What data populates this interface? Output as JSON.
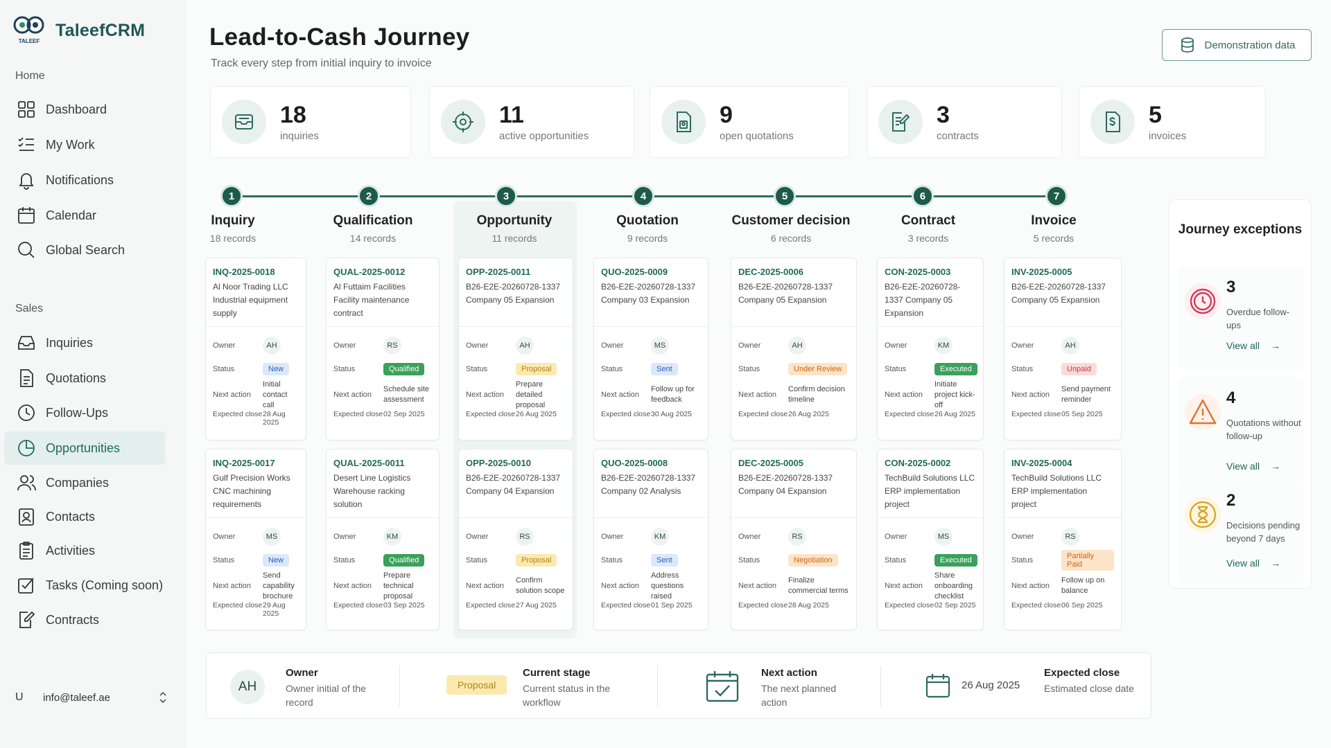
{
  "brand": {
    "name": "TaleefCRM",
    "logo_text": "TALEEF"
  },
  "sidebar": {
    "sections": {
      "home": "Home",
      "sales": "Sales"
    },
    "home_items": [
      {
        "label": "Dashboard",
        "icon": "dashboard-icon"
      },
      {
        "label": "My Work",
        "icon": "checklist-icon"
      },
      {
        "label": "Notifications",
        "icon": "bell-icon"
      },
      {
        "label": "Calendar",
        "icon": "calendar-icon"
      },
      {
        "label": "Global Search",
        "icon": "search-icon"
      }
    ],
    "sales_items": [
      {
        "label": "Inquiries",
        "icon": "inbox-icon"
      },
      {
        "label": "Quotations",
        "icon": "document-icon"
      },
      {
        "label": "Follow-Ups",
        "icon": "clock-icon"
      },
      {
        "label": "Opportunities",
        "icon": "pie-chart-icon",
        "active": true
      },
      {
        "label": "Companies",
        "icon": "users-icon"
      },
      {
        "label": "Contacts",
        "icon": "contact-card-icon"
      },
      {
        "label": "Activities",
        "icon": "clipboard-icon"
      },
      {
        "label": "Tasks (Coming soon)",
        "icon": "checkbox-icon"
      },
      {
        "label": "Contracts",
        "icon": "edit-document-icon"
      }
    ],
    "user": {
      "initial": "U",
      "email": "info@taleef.ae"
    }
  },
  "header": {
    "title": "Lead-to-Cash Journey",
    "subtitle": "Track every step from initial inquiry to invoice",
    "demo_button": "Demonstration data"
  },
  "kpis": [
    {
      "value": "18",
      "label": "inquiries"
    },
    {
      "value": "11",
      "label": "active opportunities"
    },
    {
      "value": "9",
      "label": "open quotations"
    },
    {
      "value": "3",
      "label": "contracts"
    },
    {
      "value": "5",
      "label": "invoices"
    }
  ],
  "labels": {
    "owner": "Owner",
    "status": "Status",
    "next_action": "Next action",
    "expected_close": "Expected close"
  },
  "stages": [
    {
      "num": "1",
      "name": "Inquiry",
      "count": "18 records",
      "cards": [
        {
          "code": "INQ-2025-0018",
          "desc": "Al Noor Trading LLC Industrial equipment supply",
          "owner": "AH",
          "status": "New",
          "next": "Initial contact call",
          "close": "28 Aug 2025"
        },
        {
          "code": "INQ-2025-0017",
          "desc": "Gulf Precision Works CNC machining requirements",
          "owner": "MS",
          "status": "New",
          "next": "Send capability brochure",
          "close": "29 Aug 2025"
        }
      ]
    },
    {
      "num": "2",
      "name": "Qualification",
      "count": "14 records",
      "cards": [
        {
          "code": "QUAL-2025-0012",
          "desc": "Al Futtaim Facilities Facility maintenance contract",
          "owner": "RS",
          "status": "Qualified",
          "next": "Schedule site assessment",
          "close": "02 Sep 2025"
        },
        {
          "code": "QUAL-2025-0011",
          "desc": "Desert Line Logistics Warehouse racking solution",
          "owner": "KM",
          "status": "Qualified",
          "next": "Prepare technical proposal",
          "close": "03 Sep 2025"
        }
      ]
    },
    {
      "num": "3",
      "name": "Opportunity",
      "count": "11 records",
      "cards": [
        {
          "code": "OPP-2025-0011",
          "desc": "B26-E2E-20260728-1337 Company 05 Expansion",
          "owner": "AH",
          "status": "Proposal",
          "next": "Prepare detailed proposal",
          "close": "26 Aug 2025"
        },
        {
          "code": "OPP-2025-0010",
          "desc": "B26-E2E-20260728-1337 Company 04 Expansion",
          "owner": "RS",
          "status": "Proposal",
          "next": "Confirm solution scope",
          "close": "27 Aug 2025"
        }
      ]
    },
    {
      "num": "4",
      "name": "Quotation",
      "count": "9 records",
      "cards": [
        {
          "code": "QUO-2025-0009",
          "desc": "B26-E2E-20260728-1337 Company 03 Expansion",
          "owner": "MS",
          "status": "Sent",
          "next": "Follow up for feedback",
          "close": "30 Aug 2025"
        },
        {
          "code": "QUO-2025-0008",
          "desc": "B26-E2E-20260728-1337 Company 02 Analysis",
          "owner": "KM",
          "status": "Sent",
          "next": "Address questions raised",
          "close": "01 Sep 2025"
        }
      ]
    },
    {
      "num": "5",
      "name": "Customer decision",
      "count": "6 records",
      "cards": [
        {
          "code": "DEC-2025-0006",
          "desc": "B26-E2E-20260728-1337 Company 05 Expansion",
          "owner": "AH",
          "status": "Under Review",
          "next": "Confirm decision timeline",
          "close": "26 Aug 2025"
        },
        {
          "code": "DEC-2025-0005",
          "desc": "B26-E2E-20260728-1337 Company 04 Expansion",
          "owner": "RS",
          "status": "Negotiation",
          "next": "Finalize commercial terms",
          "close": "28 Aug 2025"
        }
      ]
    },
    {
      "num": "6",
      "name": "Contract",
      "count": "3 records",
      "cards": [
        {
          "code": "CON-2025-0003",
          "desc": "B26-E2E-20260728-1337 Company 05 Expansion",
          "owner": "KM",
          "status": "Executed",
          "next": "Initiate project kick-off",
          "close": "26 Aug 2025"
        },
        {
          "code": "CON-2025-0002",
          "desc": "TechBuild Solutions LLC ERP implementation project",
          "owner": "MS",
          "status": "Executed",
          "next": "Share onboarding checklist",
          "close": "02 Sep 2025"
        }
      ]
    },
    {
      "num": "7",
      "name": "Invoice",
      "count": "5 records",
      "cards": [
        {
          "code": "INV-2025-0005",
          "desc": "B26-E2E-20260728-1337 Company 05 Expansion",
          "owner": "AH",
          "status": "Unpaid",
          "next": "Send payment reminder",
          "close": "05 Sep 2025"
        },
        {
          "code": "INV-2025-0004",
          "desc": "TechBuild Solutions LLC ERP implementation project",
          "owner": "RS",
          "status": "Partially Paid",
          "next": "Follow up on balance",
          "close": "06 Sep 2025"
        }
      ]
    }
  ],
  "status_colors": {
    "New": {
      "bg": "#dbe8fb",
      "fg": "#2d5fb0"
    },
    "Qualified": {
      "bg": "#3aa05a",
      "fg": "#ffffff"
    },
    "Proposal": {
      "bg": "#fbe9b0",
      "fg": "#b08416"
    },
    "Sent": {
      "bg": "#dbe8fb",
      "fg": "#2d5fb0"
    },
    "Under Review": {
      "bg": "#fde3c7",
      "fg": "#c76a14"
    },
    "Negotiation": {
      "bg": "#fde3c7",
      "fg": "#c76a14"
    },
    "Executed": {
      "bg": "#3aa05a",
      "fg": "#ffffff"
    },
    "Unpaid": {
      "bg": "#fbdada",
      "fg": "#c23b3b"
    },
    "Partially Paid": {
      "bg": "#fde3c7",
      "fg": "#c76a14"
    }
  },
  "exceptions": {
    "title": "Journey exceptions",
    "items": [
      {
        "count": "3",
        "text": "Overdue follow-ups",
        "link": "View all",
        "icon": "clock-alert-icon",
        "color": "#d23b5a"
      },
      {
        "count": "4",
        "text": "Quotations without follow-up",
        "link": "View all",
        "icon": "warning-icon",
        "color": "#e0722e"
      },
      {
        "count": "2",
        "text": "Decisions pending beyond 7 days",
        "link": "View all",
        "icon": "hourglass-icon",
        "color": "#d9a21b"
      }
    ]
  },
  "legend": {
    "owner_initials": "AH",
    "owner_title": "Owner",
    "owner_desc": "Owner initial of the record",
    "stage_badge": "Proposal",
    "stage_title": "Current stage",
    "stage_desc": "Current status in the workflow",
    "next_title": "Next action",
    "next_desc": "The next planned action",
    "date_value": "26 Aug 2025",
    "close_title": "Expected close",
    "close_desc": "Estimated close date"
  },
  "colors": {
    "accent": "#1e6b58",
    "active_nav_bg": "#e3efec",
    "step_dot": "#1e5a48"
  }
}
